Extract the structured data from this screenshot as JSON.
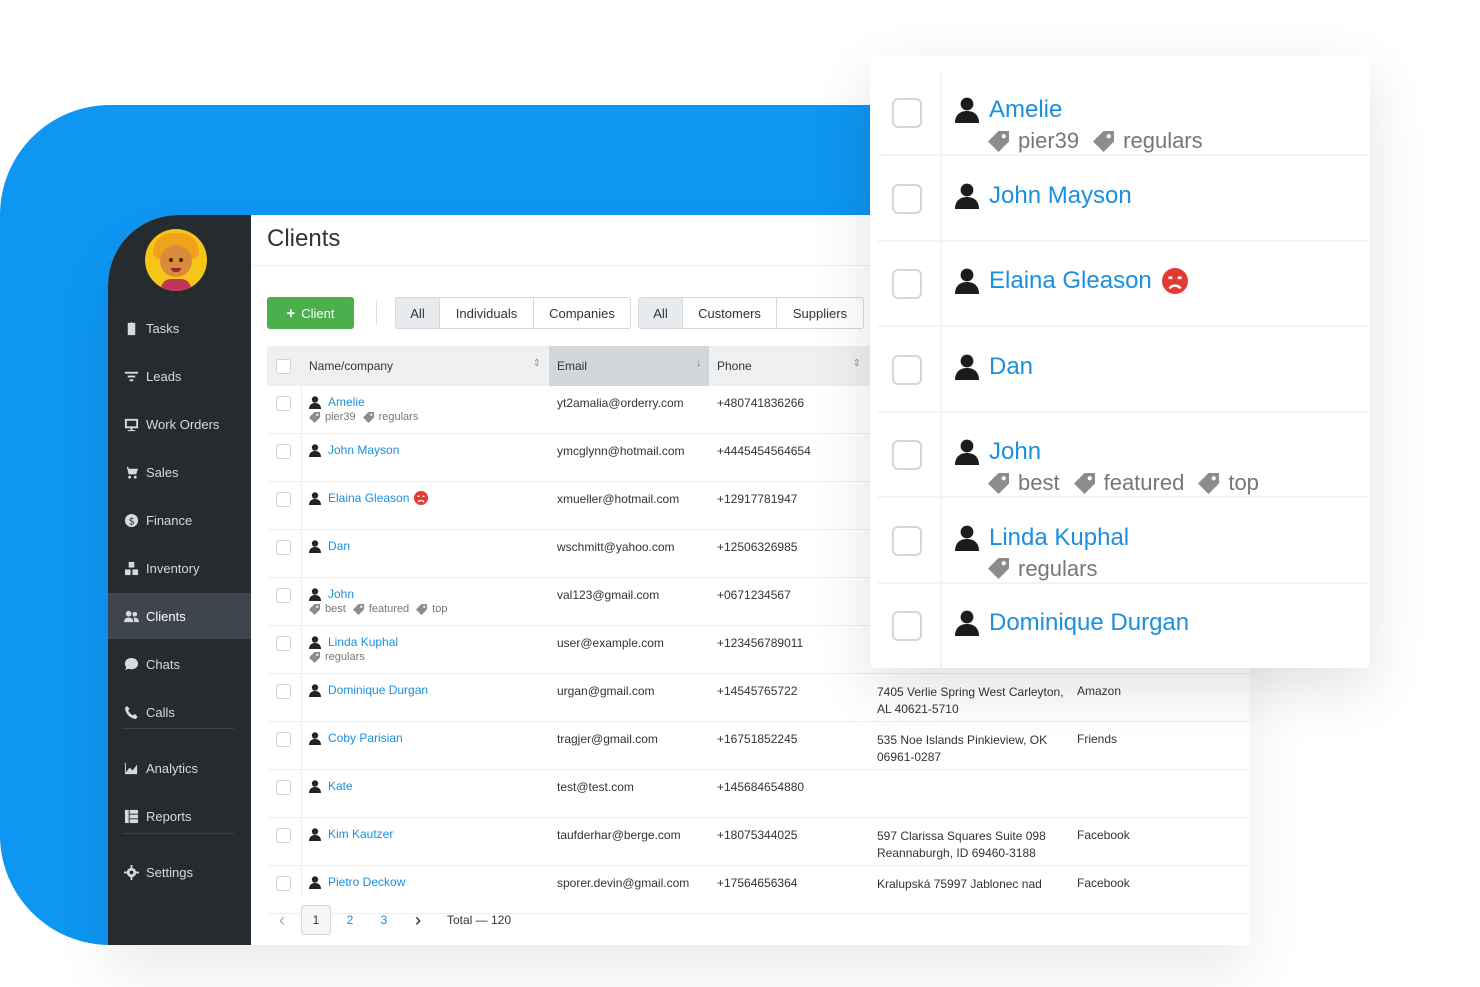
{
  "app": {
    "title": "Clients"
  },
  "sidebar": {
    "items": [
      {
        "label": "Tasks",
        "icon": "clipboard-icon"
      },
      {
        "label": "Leads",
        "icon": "filter-icon"
      },
      {
        "label": "Work Orders",
        "icon": "work-orders-icon"
      },
      {
        "label": "Sales",
        "icon": "cart-icon"
      },
      {
        "label": "Finance",
        "icon": "dollar-icon"
      },
      {
        "label": "Inventory",
        "icon": "boxes-icon"
      },
      {
        "label": "Clients",
        "icon": "users-icon",
        "active": true
      },
      {
        "label": "Chats",
        "icon": "chat-icon"
      },
      {
        "label": "Calls",
        "icon": "phone-icon"
      },
      {
        "label": "Analytics",
        "icon": "area-chart-icon"
      },
      {
        "label": "Reports",
        "icon": "reports-icon"
      },
      {
        "label": "Settings",
        "icon": "gear-icon"
      }
    ]
  },
  "toolbar": {
    "add_client_label": "Client",
    "type_filter": [
      "All",
      "Individuals",
      "Companies"
    ],
    "role_filter": [
      "All",
      "Customers",
      "Suppliers"
    ]
  },
  "table": {
    "headers": {
      "name": "Name/company",
      "email": "Email",
      "phone": "Phone"
    },
    "rows": [
      {
        "name": "Amelie",
        "tags": [
          "pier39",
          "regulars"
        ],
        "email": "yt2amalia@orderry.com",
        "phone": "+480741836266",
        "address": "",
        "source": ""
      },
      {
        "name": "John Mayson",
        "tags": [],
        "email": "ymcglynn@hotmail.com",
        "phone": "+4445454564654",
        "address": "",
        "source": ""
      },
      {
        "name": "Elaina Gleason",
        "tags": [],
        "angry": true,
        "email": "xmueller@hotmail.com",
        "phone": "+12917781947",
        "address": "",
        "source": ""
      },
      {
        "name": "Dan",
        "tags": [],
        "email": "wschmitt@yahoo.com",
        "phone": "+12506326985",
        "address": "",
        "source": ""
      },
      {
        "name": "John",
        "tags": [
          "best",
          "featured",
          "top"
        ],
        "email": "val123@gmail.com",
        "phone": "+0671234567",
        "address": "",
        "source": ""
      },
      {
        "name": "Linda Kuphal",
        "tags": [
          "regulars"
        ],
        "email": "user@example.com",
        "phone": "+123456789011",
        "address": "",
        "source": ""
      },
      {
        "name": "Dominique Durgan",
        "tags": [],
        "email": "urgan@gmail.com",
        "phone": "+14545765722",
        "address": "7405 Verlie Spring West Carleyton, AL 40621-5710",
        "source": "Amazon"
      },
      {
        "name": "Coby Parisian",
        "tags": [],
        "email": "tragjer@gmail.com",
        "phone": "+16751852245",
        "address": "535 Noe Islands Pinkieview, OK 06961-0287",
        "source": "Friends"
      },
      {
        "name": "Kate",
        "tags": [],
        "email": "test@test.com",
        "phone": "+145684654880",
        "address": "",
        "source": ""
      },
      {
        "name": "Kim Kautzer",
        "tags": [],
        "email": "taufderhar@berge.com",
        "phone": "+18075344025",
        "address": "597 Clarissa Squares Suite 098 Reannaburgh, ID 69460-3188",
        "source": "Facebook"
      },
      {
        "name": "Pietro Deckow",
        "tags": [],
        "email": "sporer.devin@gmail.com",
        "phone": "+17564656364",
        "address": "Kralupská 75997 Jablonec nad",
        "source": "Facebook"
      }
    ]
  },
  "pagination": {
    "pages": [
      "1",
      "2",
      "3"
    ],
    "current": "1",
    "total_label": "Total — 120"
  },
  "zoom_card": {
    "rows": [
      {
        "name": "Amelie",
        "tags": [
          "pier39",
          "regulars"
        ]
      },
      {
        "name": "John Mayson",
        "tags": []
      },
      {
        "name": "Elaina Gleason",
        "tags": [],
        "angry": true
      },
      {
        "name": "Dan",
        "tags": []
      },
      {
        "name": "John",
        "tags": [
          "best",
          "featured",
          "top"
        ]
      },
      {
        "name": "Linda Kuphal",
        "tags": [
          "regulars"
        ]
      },
      {
        "name": "Dominique Durgan",
        "tags": []
      }
    ]
  },
  "colors": {
    "backdrop": "#0d96f2",
    "sidebar": "#262b30",
    "link": "#1b8fe0",
    "add_button": "#4cae4c",
    "angry_badge": "#e53935"
  }
}
